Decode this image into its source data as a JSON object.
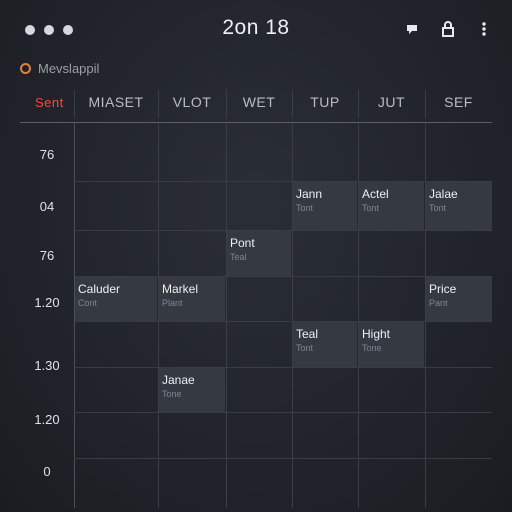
{
  "header": {
    "title": "2on 18",
    "calendar_name": "Mevslappil",
    "icons": [
      "window-dot-icon",
      "window-dot-icon",
      "window-dot-icon",
      "comment-icon",
      "lock-icon",
      "more-vertical-icon"
    ]
  },
  "columns": {
    "today": "Sent",
    "c1": "MIASET",
    "c2": "VLOT",
    "c3": "WET",
    "c4": "TUP",
    "c5": "JUT",
    "c6": "SEF"
  },
  "times": {
    "t1": "76",
    "t2": "04",
    "t3": "76",
    "t4": "1.20",
    "t5": "1.30",
    "t6": "1.20",
    "t7": "0"
  },
  "events": {
    "e1": {
      "title": "Jann",
      "sub": "Tont"
    },
    "e2": {
      "title": "Actel",
      "sub": "Tont"
    },
    "e3": {
      "title": "Jalae",
      "sub": "Tont"
    },
    "e4": {
      "title": "Pont",
      "sub": "Teal"
    },
    "e5": {
      "title": "Caluder",
      "sub": "Cont"
    },
    "e6": {
      "title": "Markel",
      "sub": "Plant"
    },
    "e7": {
      "title": "Price",
      "sub": "Pant"
    },
    "e8": {
      "title": "Teal",
      "sub": "Tont"
    },
    "e9": {
      "title": "Hight",
      "sub": "Tone"
    },
    "e10": {
      "title": "Janae",
      "sub": "Tone"
    }
  },
  "colors": {
    "today_accent": "#e8503a",
    "calendar_ring": "#e0813d",
    "event_block": "#353942",
    "background": "#1f2228"
  }
}
